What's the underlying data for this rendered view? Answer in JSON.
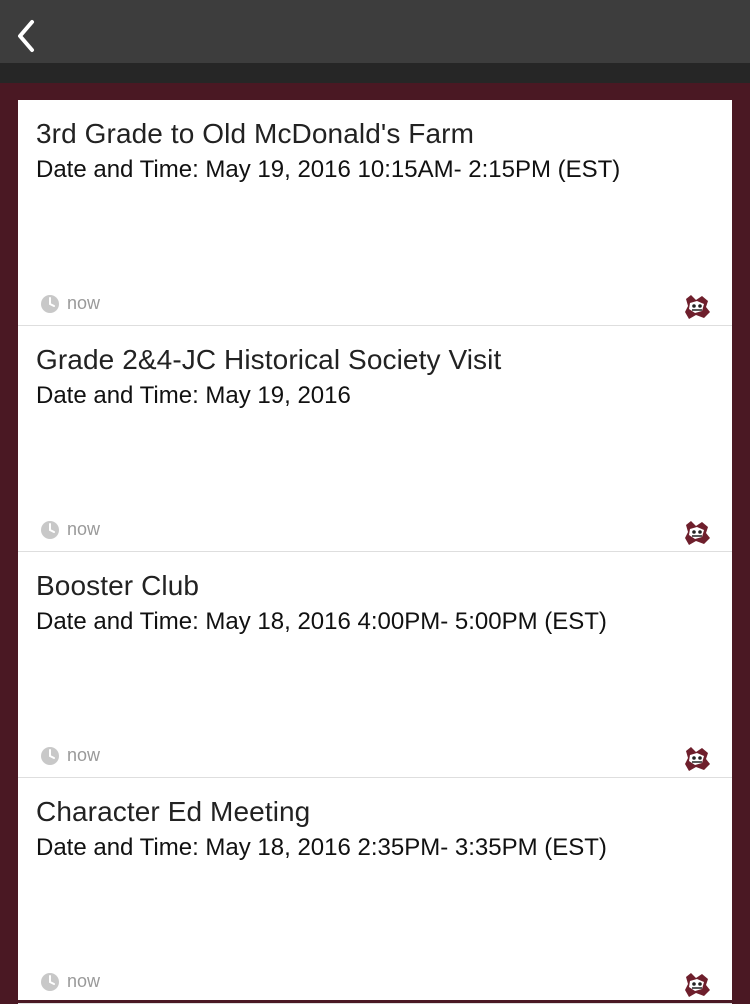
{
  "header": {
    "back_icon": "chevron-left-icon"
  },
  "posts": [
    {
      "title": "3rd Grade to Old McDonald's Farm",
      "datetime": "Date and Time: May 19, 2016 10:15AM- 2:15PM (EST)",
      "time": "now"
    },
    {
      "title": "Grade 2&4-JC Historical Society Visit",
      "datetime": "Date and Time: May 19, 2016",
      "time": "now"
    },
    {
      "title": "Booster Club",
      "datetime": "Date and Time: May 18, 2016 4:00PM- 5:00PM (EST)",
      "time": "now"
    },
    {
      "title": "Character Ed Meeting",
      "datetime": "Date and Time: May 18, 2016 2:35PM- 3:35PM (EST)",
      "time": "now"
    }
  ],
  "colors": {
    "header": "#3d3d3d",
    "frame": "#4a1823",
    "card": "#ffffff",
    "muted": "#9a9a9a"
  }
}
